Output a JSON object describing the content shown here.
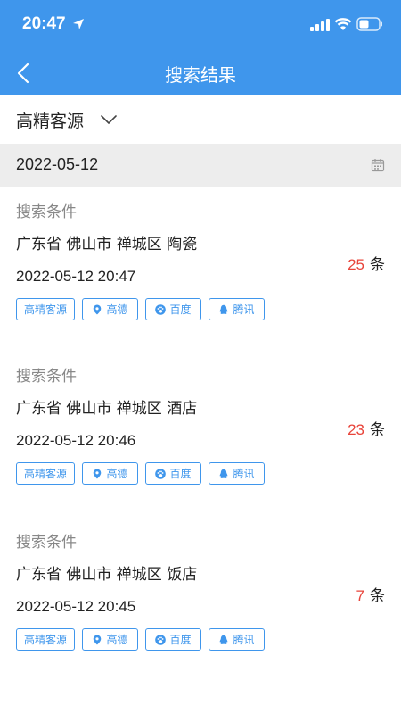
{
  "status_bar": {
    "time": "20:47"
  },
  "nav": {
    "title": "搜索结果"
  },
  "filter": {
    "label": "高精客源"
  },
  "date_row": {
    "date": "2022-05-12"
  },
  "results": [
    {
      "condition_label": "搜索条件",
      "region": "广东省 佛山市 禅城区 陶瓷",
      "time": "2022-05-12 20:47",
      "count": "25",
      "unit": "条",
      "tags": [
        "高精客源",
        "高德",
        "百度",
        "腾讯"
      ]
    },
    {
      "condition_label": "搜索条件",
      "region": "广东省 佛山市 禅城区 酒店",
      "time": "2022-05-12 20:46",
      "count": "23",
      "unit": "条",
      "tags": [
        "高精客源",
        "高德",
        "百度",
        "腾讯"
      ]
    },
    {
      "condition_label": "搜索条件",
      "region": "广东省 佛山市 禅城区 饭店",
      "time": "2022-05-12 20:45",
      "count": "7",
      "unit": "条",
      "tags": [
        "高精客源",
        "高德",
        "百度",
        "腾讯"
      ]
    }
  ],
  "colors": {
    "primary": "#3f96ec",
    "count": "#e8443a",
    "date_bg": "#ededed"
  },
  "icons": [
    "location-arrow-icon",
    "signal-icon",
    "wifi-icon",
    "battery-icon",
    "back-chevron-icon",
    "chevron-down-icon",
    "calendar-icon",
    "map-pin-icon",
    "paw-icon",
    "penguin-icon"
  ]
}
